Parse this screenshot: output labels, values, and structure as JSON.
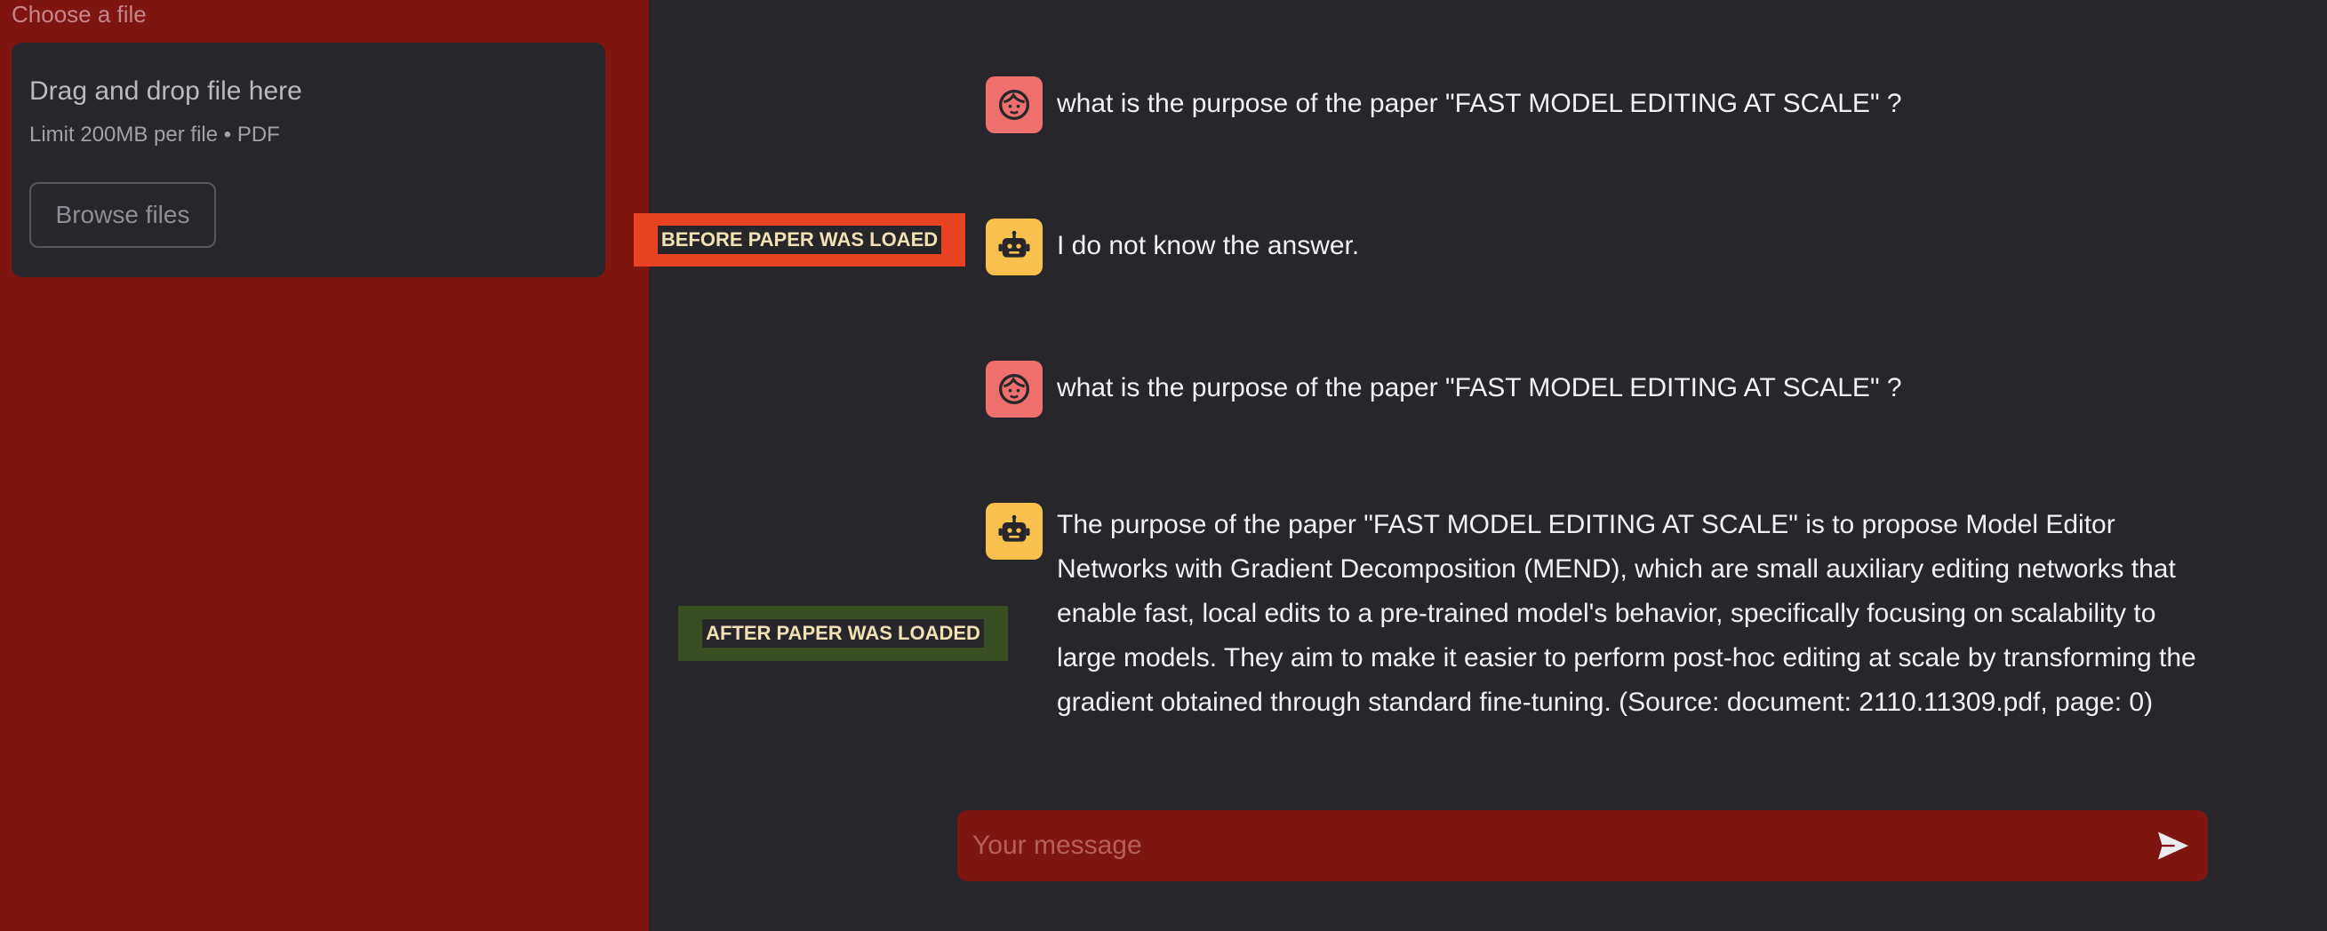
{
  "sidebar": {
    "caption": "Choose a file",
    "dropzone": {
      "title": "Drag and drop file here",
      "limit": "Limit 200MB per file • PDF",
      "browse_label": "Browse files"
    }
  },
  "annotations": {
    "before": "BEFORE PAPER WAS LOAED",
    "after": "AFTER PAPER WAS LOADED"
  },
  "messages": [
    {
      "role": "user",
      "icon": "user-face-icon",
      "text": "what is the purpose of the paper \"FAST MODEL EDITING AT SCALE\" ?"
    },
    {
      "role": "assistant",
      "icon": "robot-icon",
      "text": "I do not know the answer."
    },
    {
      "role": "user",
      "icon": "user-face-icon",
      "text": "what is the purpose of the paper \"FAST MODEL EDITING AT SCALE\" ?"
    },
    {
      "role": "assistant",
      "icon": "robot-icon",
      "text": "The purpose of the paper \"FAST MODEL EDITING AT SCALE\" is to propose Model Editor Networks with Gradient Decomposition (MEND), which are small auxiliary editing networks that enable fast, local edits to a pre-trained model's behavior, specifically focusing on scalability to large models. They aim to make it easier to perform post-hoc editing at scale by transforming the gradient obtained through standard fine-tuning. (Source: document: 2110.11309.pdf, page: 0)"
    }
  ],
  "chat_input": {
    "placeholder": "Your message",
    "send_icon": "send-icon"
  },
  "colors": {
    "sidebar_bg": "#7e150f",
    "main_bg": "#26262b",
    "user_avatar": "#ef6f6c",
    "bot_avatar": "#f8c14d",
    "annotation_before": "#e84424",
    "annotation_after": "#394f23"
  }
}
